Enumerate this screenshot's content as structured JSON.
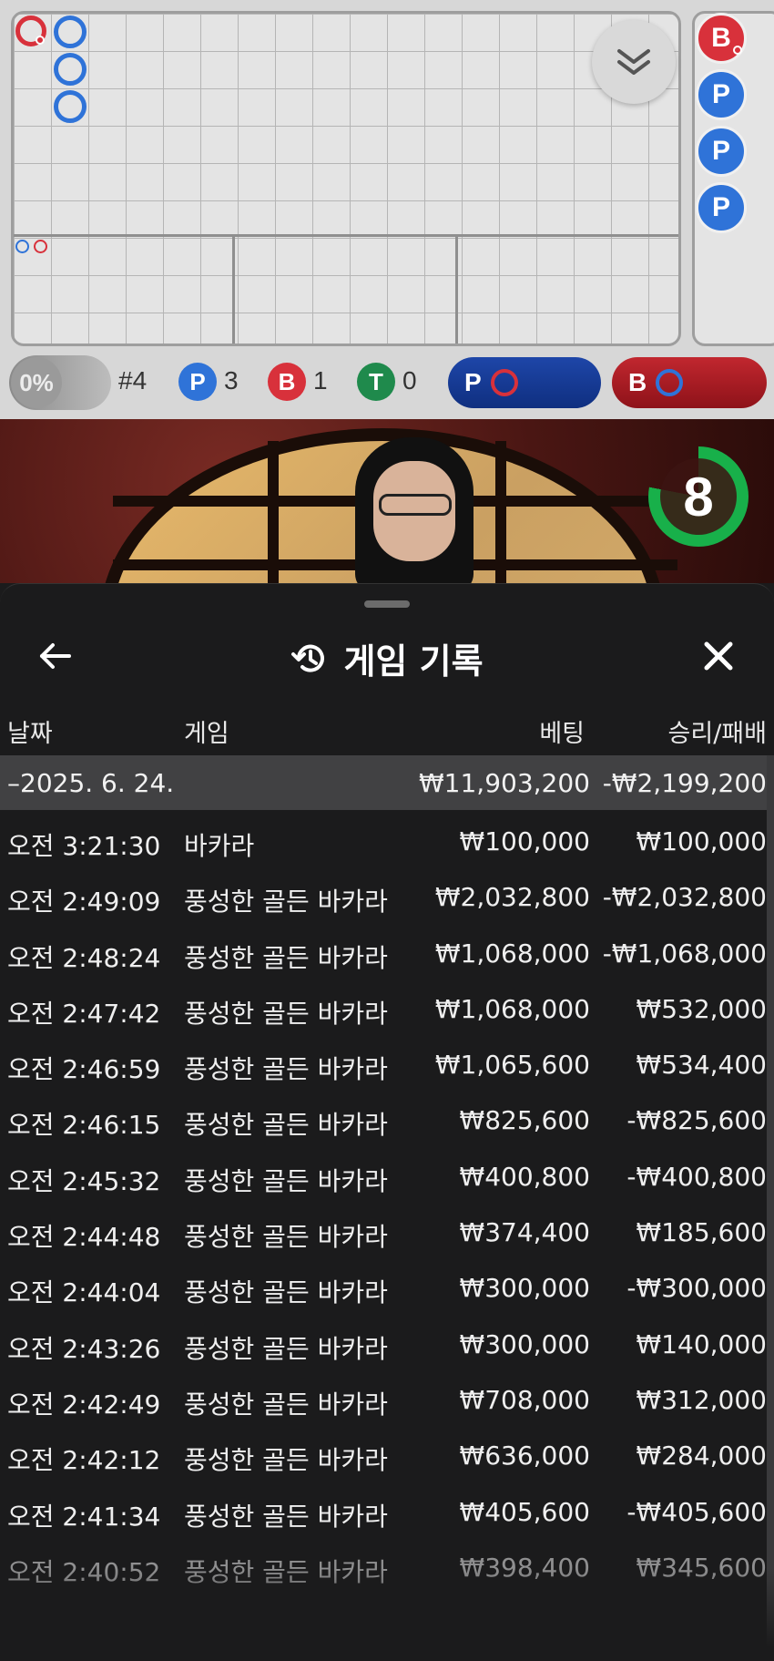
{
  "stats": {
    "percent": "0%",
    "shoe": "#4",
    "player_letter": "P",
    "player_count": "3",
    "banker_letter": "B",
    "banker_count": "1",
    "tie_letter": "T",
    "tie_count": "0",
    "player_predict": "P",
    "banker_predict": "B"
  },
  "bead_road": [
    "B",
    "P",
    "P",
    "P"
  ],
  "timer": "8",
  "colors": {
    "player": "#2f73d8",
    "banker": "#d8313b",
    "tie": "#1f8a4c",
    "accent_green": "#18b04a"
  },
  "history": {
    "title": "게임 기록",
    "icons": {
      "back": "arrow-left-icon",
      "history": "history-icon",
      "close": "close-icon",
      "collapse": "chevron-double-down-icon"
    },
    "columns": {
      "date": "날짜",
      "game": "게임",
      "bet": "베팅",
      "result": "승리/패배"
    },
    "day": {
      "date": "–2025. 6. 24.",
      "bet": "₩11,903,200",
      "result": "-₩2,199,200"
    },
    "rows": [
      {
        "time": "오전 3:21:30",
        "game": "바카라",
        "bet": "₩100,000",
        "result": "₩100,000"
      },
      {
        "time": "오전 2:49:09",
        "game": "풍성한 골든 바카라",
        "bet": "₩2,032,800",
        "result": "-₩2,032,800"
      },
      {
        "time": "오전 2:48:24",
        "game": "풍성한 골든 바카라",
        "bet": "₩1,068,000",
        "result": "-₩1,068,000"
      },
      {
        "time": "오전 2:47:42",
        "game": "풍성한 골든 바카라",
        "bet": "₩1,068,000",
        "result": "₩532,000"
      },
      {
        "time": "오전 2:46:59",
        "game": "풍성한 골든 바카라",
        "bet": "₩1,065,600",
        "result": "₩534,400"
      },
      {
        "time": "오전 2:46:15",
        "game": "풍성한 골든 바카라",
        "bet": "₩825,600",
        "result": "-₩825,600"
      },
      {
        "time": "오전 2:45:32",
        "game": "풍성한 골든 바카라",
        "bet": "₩400,800",
        "result": "-₩400,800"
      },
      {
        "time": "오전 2:44:48",
        "game": "풍성한 골든 바카라",
        "bet": "₩374,400",
        "result": "₩185,600"
      },
      {
        "time": "오전 2:44:04",
        "game": "풍성한 골든 바카라",
        "bet": "₩300,000",
        "result": "-₩300,000"
      },
      {
        "time": "오전 2:43:26",
        "game": "풍성한 골든 바카라",
        "bet": "₩300,000",
        "result": "₩140,000"
      },
      {
        "time": "오전 2:42:49",
        "game": "풍성한 골든 바카라",
        "bet": "₩708,000",
        "result": "₩312,000"
      },
      {
        "time": "오전 2:42:12",
        "game": "풍성한 골든 바카라",
        "bet": "₩636,000",
        "result": "₩284,000"
      },
      {
        "time": "오전 2:41:34",
        "game": "풍성한 골든 바카라",
        "bet": "₩405,600",
        "result": "-₩405,600"
      },
      {
        "time": "오전 2:40:52",
        "game": "풍성한 골든 바카라",
        "bet": "₩398,400",
        "result": "₩345,600"
      }
    ]
  }
}
